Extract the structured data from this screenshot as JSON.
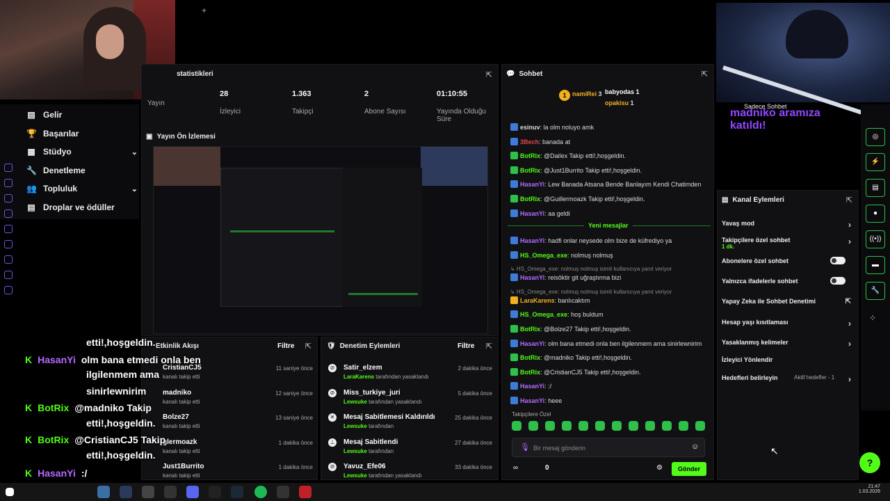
{
  "stats": {
    "title": "statistikleri",
    "items": [
      {
        "value": "",
        "label": "Yayın"
      },
      {
        "value": "28",
        "label": "İzleyici"
      },
      {
        "value": "1.363",
        "label": "Takipçi"
      },
      {
        "value": "2",
        "label": "Abone Sayısı"
      },
      {
        "value": "01:10:55",
        "label": "Yayında Olduğu Süre"
      }
    ]
  },
  "nav": {
    "items": [
      {
        "label": "Gelir",
        "icon": "▤"
      },
      {
        "label": "Başarılar",
        "icon": "🏆"
      },
      {
        "label": "Stüdyo",
        "icon": "▦",
        "chev": "⌄"
      },
      {
        "label": "Denetleme",
        "icon": "🔧"
      },
      {
        "label": "Topluluk",
        "icon": "👥",
        "chev": "⌄"
      },
      {
        "label": "Droplar ve ödüller",
        "icon": "▤"
      }
    ]
  },
  "preview": {
    "title": "Yayın Ön İzlemesi"
  },
  "activity": {
    "title": "Etkinlik Akışı",
    "filter": "Filtre",
    "items": [
      {
        "name": "CristianCJ5",
        "sub": "kanalı takip etti",
        "time": "11 saniye önce"
      },
      {
        "name": "madniko",
        "sub": "kanalı takip etti",
        "time": "12 saniye önce"
      },
      {
        "name": "Bolze27",
        "sub": "kanalı takip etti",
        "time": "13 saniye önce"
      },
      {
        "name": "glermoazk",
        "sub": "kanalı takip etti",
        "time": "1 dakika önce"
      },
      {
        "name": "Just1Burrito",
        "sub": "kanalı takip etti",
        "time": "1 dakika önce"
      }
    ]
  },
  "moderation": {
    "title": "Denetim Eylemleri",
    "filter": "Filtre",
    "items": [
      {
        "name": "Satir_elzem",
        "by": "LaraKarens",
        "sub": "tarafından yasaklandı",
        "time": "2 dakika önce"
      },
      {
        "name": "Miss_turkiye_juri",
        "by": "Lewsuke",
        "sub": "tarafından yasaklandı",
        "time": "5 dakika önce"
      },
      {
        "name": "Mesaj Sabitlemesi Kaldırıldı",
        "by": "Lewsuke",
        "sub": "tarafından",
        "time": "25 dakika önce"
      },
      {
        "name": "Mesaj Sabitlendi",
        "by": "Lewsuke",
        "sub": "tarafından",
        "time": "27 dakika önce"
      },
      {
        "name": "Yavuz_Efe06",
        "by": "Lewsuke",
        "sub": "tarafından yasaklandı",
        "time": "33 dakika önce"
      }
    ]
  },
  "chat": {
    "title": "Sohbet",
    "top": [
      {
        "rank": "1",
        "name": "namiRei",
        "count": "3"
      },
      {
        "name": "babyodas",
        "count": "1"
      },
      {
        "name": "opakisu",
        "count": "1"
      }
    ],
    "messages": [
      {
        "user": "esinuv",
        "text": "la olm noluyo amk",
        "color": "#ddd"
      },
      {
        "user": "3Bech",
        "text": "banada at",
        "color": "#e04a4a"
      },
      {
        "user": "BotRix",
        "text": "@Dailex Takip etti!,hoşgeldin.",
        "color": "#53fc18"
      },
      {
        "user": "BotRix",
        "text": "@Just1Burrito Takip etti!,hoşgeldin.",
        "color": "#53fc18"
      },
      {
        "user": "HasanYi",
        "text": "Lew Banada Atsana Bende Banlayım Kendi Chatimden",
        "color": "#b36bff"
      },
      {
        "user": "BotRix",
        "text": "@Guillermoazk Takip etti!,hoşgeldin.",
        "color": "#53fc18"
      },
      {
        "user": "HasanYi",
        "text": "aa geldi",
        "color": "#b36bff"
      }
    ],
    "new_label": "Yeni mesajlar",
    "messages2": [
      {
        "user": "HasanYi",
        "text": "hadfi onlar neysede olm bize de küfrediyo ya",
        "color": "#b36bff"
      },
      {
        "user": "HS_Omega_exe",
        "text": "nolmuş nolmuş",
        "color": "#53fc18"
      },
      {
        "user": "",
        "text": "↳ HS_Omega_exe: nolmuş nolmuş isimli kullanıcıya yanıt veriyor",
        "color": "#888"
      },
      {
        "user": "HasanYi",
        "text": "reisöktir git uğraştırma bizi",
        "color": "#b36bff"
      },
      {
        "user": "",
        "text": "↳ HS_Omega_exe: nolmuş nolmuş isimli kullanıcıya yanıt veriyor",
        "color": "#888"
      },
      {
        "user": "LaraKarens",
        "text": "banlıcaktım",
        "color": "#f0b020"
      },
      {
        "user": "HS_Omega_exe",
        "text": "hoş buldum",
        "color": "#53fc18"
      },
      {
        "user": "BotRix",
        "text": "@Bolze27 Takip etti!,hoşgeldin.",
        "color": "#53fc18"
      },
      {
        "user": "HasanYi",
        "text": "olm bana etmedi onla ben ilgilenmem ama sinirlewnirim",
        "color": "#b36bff"
      },
      {
        "user": "BotRix",
        "text": "@madniko Takip etti!,hoşgeldin.",
        "color": "#53fc18"
      },
      {
        "user": "BotRix",
        "text": "@CristianCJ5 Takip etti!,hoşgeldin.",
        "color": "#53fc18"
      },
      {
        "user": "HasanYi",
        "text": ":/",
        "color": "#b36bff"
      },
      {
        "user": "HasanYi",
        "text": "heee",
        "color": "#b36bff"
      }
    ],
    "followers_only": "Takipçilere Özel",
    "placeholder": "Bir mesaj gönderin",
    "send": "Gönder",
    "count": "0"
  },
  "actions": {
    "title": "Kanal Eylemleri",
    "items": [
      {
        "label": "Yavaş mod",
        "kind": "arrow"
      },
      {
        "label": "Takipçilere özel sohbet",
        "sub": "1 dk.",
        "kind": "arrow"
      },
      {
        "label": "Abonelere özel sohbet",
        "kind": "toggle"
      },
      {
        "label": "Yalnızca ifadelerle sohbet",
        "kind": "toggle"
      },
      {
        "label": "Yapay Zeka ile Sohbet Denetimi",
        "kind": "ext"
      },
      {
        "label": "Hesap yaşı kısıtlaması",
        "kind": "arrow"
      },
      {
        "label": "Yasaklanmış kelimeler",
        "kind": "arrow"
      },
      {
        "label": "İzleyici Yönlendir",
        "kind": "none"
      },
      {
        "label": "Hedefleri belirleyin",
        "sub": "Aktif hedefler - 1",
        "kind": "arrow"
      }
    ]
  },
  "alert": {
    "label": "Sadece Sohbet",
    "text": "madniko aramıza katıldı!"
  },
  "overlay": {
    "lines": [
      {
        "user": "",
        "text": "etti!,hoşgeldin."
      },
      {
        "user": "HasanYi",
        "text": "olm bana etmedi onla ben"
      },
      {
        "user": "",
        "text": "ilgilenmem ama"
      },
      {
        "user": "",
        "text": "sinirlewnirim"
      },
      {
        "user": "BotRix",
        "text": "@madniko Takip"
      },
      {
        "user": "",
        "text": "etti!,hoşgeldin."
      },
      {
        "user": "BotRix",
        "text": "@CristianCJ5 Takip"
      },
      {
        "user": "",
        "text": "etti!,hoşgeldin."
      },
      {
        "user": "HasanYi",
        "text": ":/"
      },
      {
        "user": "HasanYi",
        "text": "heee"
      }
    ]
  },
  "taskbar": {
    "time": "21:47",
    "date": "1.03.2026"
  },
  "colors": {
    "accent": "#53fc18",
    "purple": "#b36bff"
  }
}
